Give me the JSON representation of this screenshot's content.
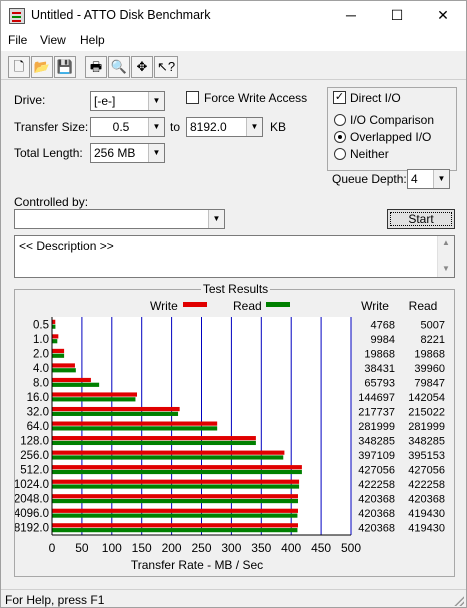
{
  "window": {
    "title": "Untitled - ATTO Disk Benchmark"
  },
  "title_buttons": {
    "minimize": "─",
    "maximize": "☐",
    "close": "✕"
  },
  "menu": [
    "File",
    "View",
    "Help"
  ],
  "toolbar": {
    "buttons": [
      {
        "icon": "new-document-icon",
        "glyph": "🗋"
      },
      {
        "icon": "open-folder-icon",
        "glyph": "📂"
      },
      {
        "icon": "save-icon",
        "glyph": "💾"
      },
      {
        "icon": "print-icon",
        "glyph": "🖶"
      },
      {
        "icon": "print-preview-icon",
        "glyph": "🔍"
      },
      {
        "icon": "move-icon",
        "glyph": "✥"
      },
      {
        "icon": "context-help-icon",
        "glyph": "↖?"
      }
    ]
  },
  "settings": {
    "drive_label": "Drive:",
    "drive_value": "[-e-]",
    "force_write_label": "Force Write Access",
    "force_write_checked": false,
    "direct_io_label": "Direct I/O",
    "direct_io_checked": true,
    "transfer_size_label": "Transfer Size:",
    "transfer_from": "0.5",
    "to_label": "to",
    "transfer_to": "8192.0",
    "unit_label": "KB",
    "total_length_label": "Total Length:",
    "total_length_value": "256 MB",
    "io_comparison_label": "I/O Comparison",
    "overlapped_io_label": "Overlapped I/O",
    "neither_label": "Neither",
    "selected_mode": "Overlapped I/O",
    "queue_depth_label": "Queue Depth:",
    "queue_depth_value": "4",
    "controlled_by_label": "Controlled by:",
    "controlled_by_value": "",
    "start_label": "Start",
    "description_text": "<< Description >>"
  },
  "results": {
    "title": "Test Results",
    "legend_write": "Write",
    "legend_read": "Read",
    "col_write": "Write",
    "col_read": "Read",
    "rows": [
      {
        "size": "0.5",
        "write": "4768",
        "read": "5007"
      },
      {
        "size": "1.0",
        "write": "9984",
        "read": "8221"
      },
      {
        "size": "2.0",
        "write": "19868",
        "read": "19868"
      },
      {
        "size": "4.0",
        "write": "38431",
        "read": "39960"
      },
      {
        "size": "8.0",
        "write": "65793",
        "read": "79847"
      },
      {
        "size": "16.0",
        "write": "144697",
        "read": "142054"
      },
      {
        "size": "32.0",
        "write": "217737",
        "read": "215022"
      },
      {
        "size": "64.0",
        "write": "281999",
        "read": "281999"
      },
      {
        "size": "128.0",
        "write": "348285",
        "read": "348285"
      },
      {
        "size": "256.0",
        "write": "397109",
        "read": "395153"
      },
      {
        "size": "512.0",
        "write": "427056",
        "read": "427056"
      },
      {
        "size": "1024.0",
        "write": "422258",
        "read": "422258"
      },
      {
        "size": "2048.0",
        "write": "420368",
        "read": "420368"
      },
      {
        "size": "4096.0",
        "write": "420368",
        "read": "419430"
      },
      {
        "size": "8192.0",
        "write": "420368",
        "read": "419430"
      }
    ]
  },
  "chart_data": {
    "type": "bar",
    "orientation": "horizontal",
    "title": "Test Results",
    "xlabel": "Transfer Rate - MB / Sec",
    "ylabel": "",
    "xlim": [
      0,
      500
    ],
    "xticks": [
      "0",
      "50",
      "100",
      "150",
      "200",
      "250",
      "300",
      "350",
      "400",
      "450",
      "500"
    ],
    "categories": [
      "0.5",
      "1.0",
      "2.0",
      "4.0",
      "8.0",
      "16.0",
      "32.0",
      "64.0",
      "128.0",
      "256.0",
      "512.0",
      "1024.0",
      "2048.0",
      "4096.0",
      "8192.0"
    ],
    "series": [
      {
        "name": "Write",
        "color": "#e00000",
        "values": [
          4.66,
          9.75,
          19.4,
          37.53,
          64.25,
          141.31,
          212.63,
          275.39,
          340.12,
          387.8,
          417.05,
          412.36,
          410.52,
          410.52,
          410.52
        ]
      },
      {
        "name": "Read",
        "color": "#008000",
        "values": [
          4.89,
          8.03,
          19.4,
          39.02,
          77.98,
          138.72,
          209.98,
          275.39,
          340.12,
          385.89,
          417.05,
          412.36,
          410.52,
          409.6,
          409.6
        ]
      }
    ],
    "grid": "vertical",
    "legend": "top",
    "gridline_color": "#0000c0"
  },
  "status": {
    "text": "For Help, press F1"
  }
}
